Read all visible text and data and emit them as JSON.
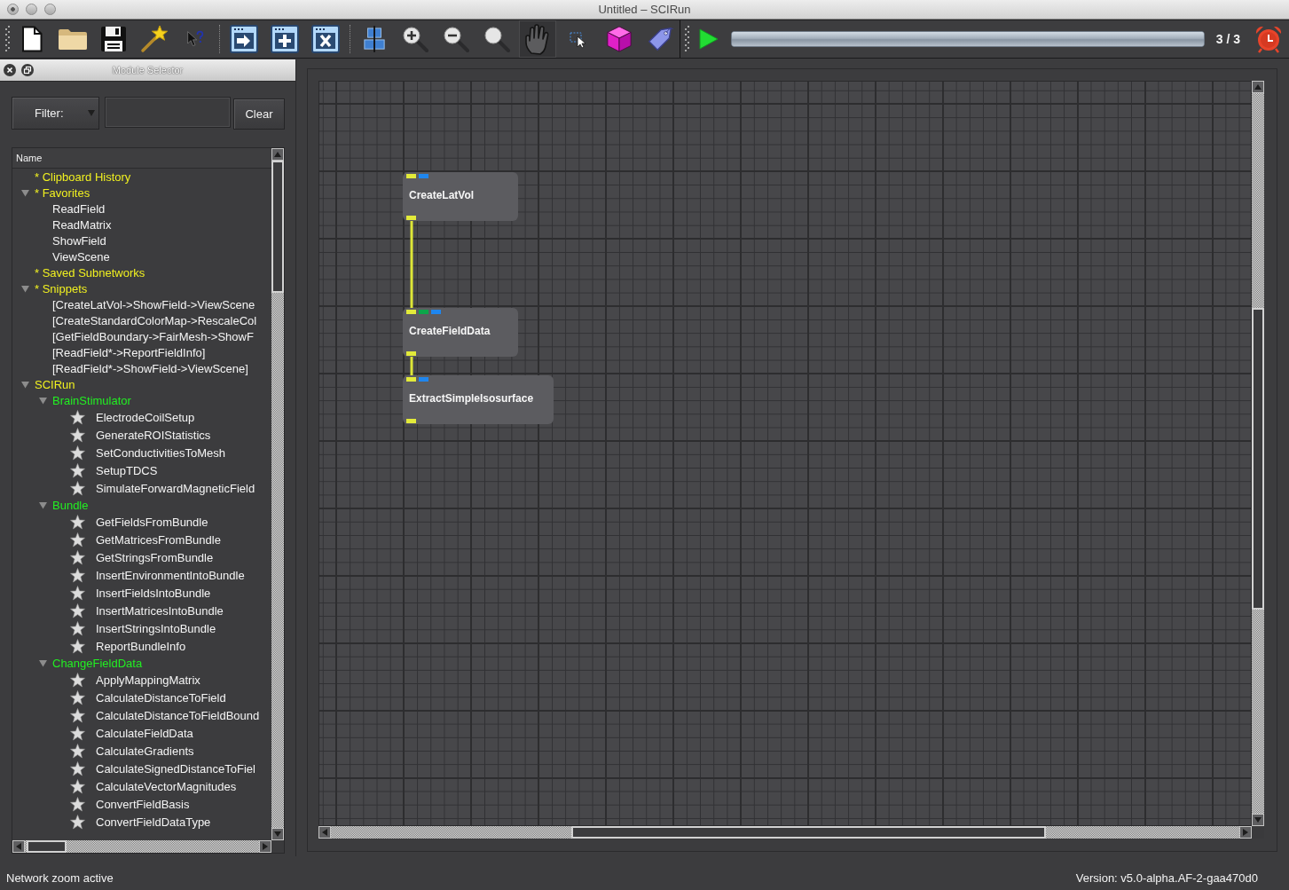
{
  "window": {
    "title": "Untitled – SCIRun"
  },
  "toolbar": {
    "pan_tool_on": true,
    "progress": {
      "level": 1
    },
    "execution_count": "3 / 3"
  },
  "module_selector": {
    "title": "Module Selector",
    "filter_button": "Filter:",
    "clear_button": "Clear",
    "column_header": "Name",
    "tree": [
      {
        "label": "* Clipboard History",
        "kind": "folder"
      },
      {
        "label": "* Favorites",
        "kind": "folder",
        "expanded": true,
        "children": [
          {
            "label": "ReadField",
            "kind": "entry"
          },
          {
            "label": "ReadMatrix",
            "kind": "entry"
          },
          {
            "label": "ShowField",
            "kind": "entry"
          },
          {
            "label": "ViewScene",
            "kind": "entry"
          }
        ]
      },
      {
        "label": "* Saved Subnetworks",
        "kind": "folder"
      },
      {
        "label": "* Snippets",
        "kind": "folder",
        "expanded": true,
        "children": [
          {
            "label": "[CreateLatVol->ShowField->ViewScene",
            "kind": "entry"
          },
          {
            "label": "[CreateStandardColorMap->RescaleCol",
            "kind": "entry"
          },
          {
            "label": "[GetFieldBoundary->FairMesh->ShowF",
            "kind": "entry"
          },
          {
            "label": "[ReadField*->ReportFieldInfo]",
            "kind": "entry"
          },
          {
            "label": "[ReadField*->ShowField->ViewScene]",
            "kind": "entry"
          }
        ]
      },
      {
        "label": "SCIRun",
        "kind": "folder",
        "expanded": true,
        "children": [
          {
            "label": "BrainStimulator",
            "kind": "category",
            "expanded": true,
            "children": [
              {
                "label": "ElectrodeCoilSetup",
                "kind": "module"
              },
              {
                "label": "GenerateROIStatistics",
                "kind": "module"
              },
              {
                "label": "SetConductivitiesToMesh",
                "kind": "module"
              },
              {
                "label": "SetupTDCS",
                "kind": "module"
              },
              {
                "label": "SimulateForwardMagneticField",
                "kind": "module"
              }
            ]
          },
          {
            "label": "Bundle",
            "kind": "category",
            "expanded": true,
            "children": [
              {
                "label": "GetFieldsFromBundle",
                "kind": "module"
              },
              {
                "label": "GetMatricesFromBundle",
                "kind": "module"
              },
              {
                "label": "GetStringsFromBundle",
                "kind": "module"
              },
              {
                "label": "InsertEnvironmentIntoBundle",
                "kind": "module"
              },
              {
                "label": "InsertFieldsIntoBundle",
                "kind": "module"
              },
              {
                "label": "InsertMatricesIntoBundle",
                "kind": "module"
              },
              {
                "label": "InsertStringsIntoBundle",
                "kind": "module"
              },
              {
                "label": "ReportBundleInfo",
                "kind": "module"
              }
            ]
          },
          {
            "label": "ChangeFieldData",
            "kind": "category",
            "expanded": true,
            "children": [
              {
                "label": "ApplyMappingMatrix",
                "kind": "module"
              },
              {
                "label": "CalculateDistanceToField",
                "kind": "module"
              },
              {
                "label": "CalculateDistanceToFieldBound",
                "kind": "module"
              },
              {
                "label": "CalculateFieldData",
                "kind": "module"
              },
              {
                "label": "CalculateGradients",
                "kind": "module"
              },
              {
                "label": "CalculateSignedDistanceToFiel",
                "kind": "module"
              },
              {
                "label": "CalculateVectorMagnitudes",
                "kind": "module"
              },
              {
                "label": "ConvertFieldBasis",
                "kind": "module"
              },
              {
                "label": "ConvertFieldDataType",
                "kind": "module"
              }
            ]
          }
        ]
      }
    ]
  },
  "network": {
    "modules": [
      {
        "title": "CreateLatVol",
        "inputs": [
          {
            "color": "#e2ea3a",
            "connected": false
          },
          {
            "color": "#1f86ee",
            "connected": false
          }
        ],
        "outputs": [
          {
            "color": "#e2ea3a"
          }
        ]
      },
      {
        "title": "CreateFieldData",
        "inputs": [
          {
            "color": "#e2ea3a",
            "connected": true
          },
          {
            "color": "#0ca64a",
            "connected": false
          },
          {
            "color": "#1f86ee",
            "connected": false
          }
        ],
        "outputs": [
          {
            "color": "#e2ea3a"
          }
        ]
      },
      {
        "title": "ExtractSimpleIsosurface",
        "inputs": [
          {
            "color": "#e2ea3a",
            "connected": true
          },
          {
            "color": "#1f86ee",
            "connected": false
          }
        ],
        "outputs": [
          {
            "color": "#e2ea3a"
          }
        ]
      }
    ]
  },
  "status_bar": {
    "message": "Network zoom active",
    "version": "Version: v5.0-alpha.AF-2-gaa470d0"
  }
}
